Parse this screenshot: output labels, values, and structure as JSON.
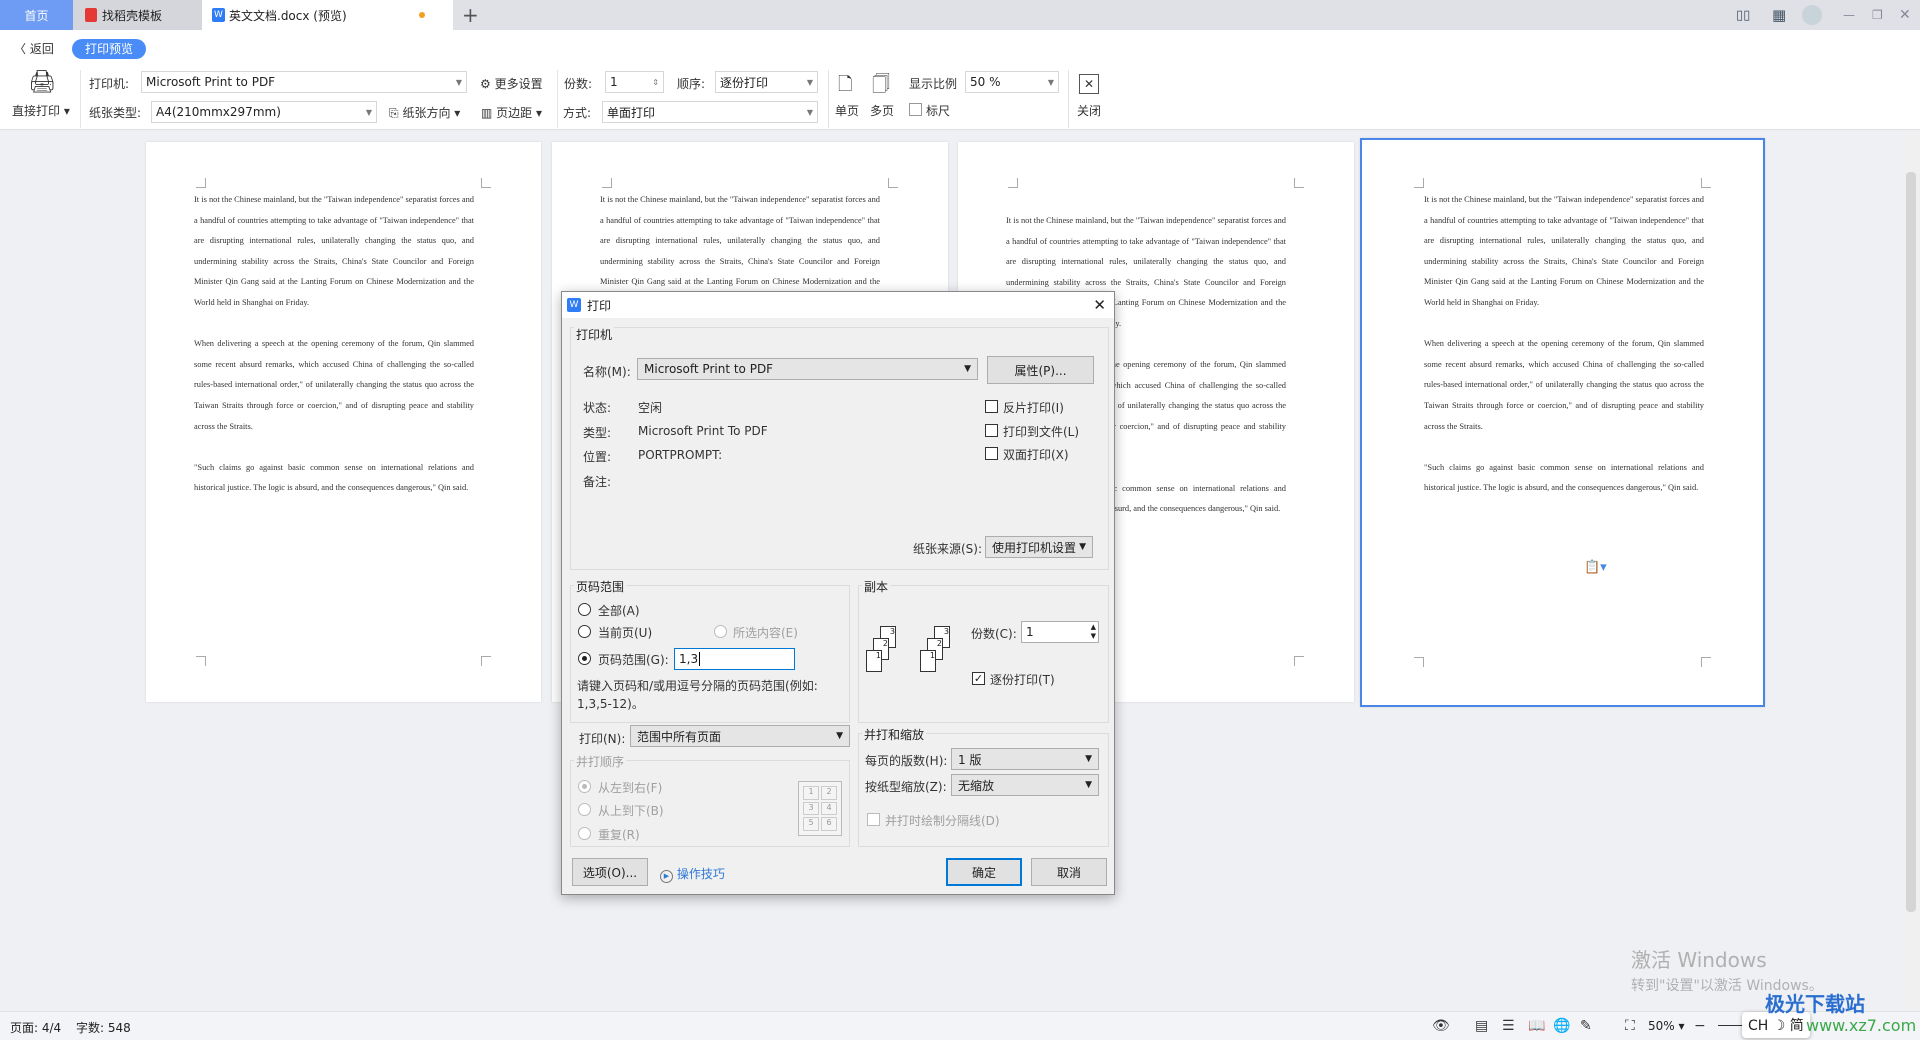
{
  "tabs": [
    {
      "label": "首页",
      "active": false
    },
    {
      "label": "找稻壳模板"
    },
    {
      "label": "英文文档.docx (预览)",
      "modified": true
    }
  ],
  "new_tab": "+",
  "nav": {
    "back": "返回",
    "mode": "打印预览"
  },
  "toolbar": {
    "direct_print": "直接打印",
    "printer_label": "打印机:",
    "printer": "Microsoft Print to PDF",
    "more_settings": "更多设置",
    "copies_label": "份数:",
    "copies": "1",
    "order_label": "顺序:",
    "order": "逐份打印",
    "paper_label": "纸张类型:",
    "paper": "A4(210mmx297mm)",
    "orientation": "纸张方向",
    "margins": "页边距",
    "mode_label": "方式:",
    "mode": "单面打印",
    "single_page": "单页",
    "multi_page": "多页",
    "zoom_label": "显示比例",
    "zoom": "50 %",
    "ruler": "标尺",
    "close": "关闭"
  },
  "document": {
    "paragraphs": [
      "It is not the Chinese mainland, but the \"Taiwan independence\" separatist forces and a handful of countries attempting to take advantage of \"Taiwan independence\" that are disrupting international rules, unilaterally changing the status quo, and undermining stability across the Straits, China's State Councilor and Foreign Minister Qin Gang said at the Lanting Forum on Chinese Modernization and the World held in Shanghai on Friday.",
      "When delivering a speech at the opening ceremony of the forum, Qin slammed some recent absurd remarks, which accused China of challenging the so-called rules-based international order,\" of unilaterally changing the status quo across the Taiwan Straits through force or coercion,\" and of disrupting peace and stability across the Straits.",
      "\"Such claims go against basic common sense on international relations and historical justice. The logic is absurd, and the consequences dangerous,\" Qin said."
    ]
  },
  "dialog": {
    "title": "打印",
    "printer_group": "打印机",
    "name_label": "名称(M):",
    "name": "Microsoft Print to PDF",
    "properties": "属性(P)...",
    "status_label": "状态:",
    "status": "空闲",
    "type_label": "类型:",
    "type": "Microsoft Print To PDF",
    "location_label": "位置:",
    "location": "PORTPROMPT:",
    "comment_label": "备注:",
    "reverse": "反片打印(I)",
    "to_file": "打印到文件(L)",
    "duplex": "双面打印(X)",
    "source_label": "纸张来源(S):",
    "source": "使用打印机设置",
    "range_group": "页码范围",
    "all": "全部(A)",
    "current": "当前页(U)",
    "selection": "所选内容(E)",
    "pages": "页码范围(G):",
    "pages_value": "1,3",
    "hint1": "请键入页码和/或用逗号分隔的页码范围(例如:",
    "hint2": "1,3,5-12)。",
    "copies_group": "副本",
    "copies_label": "份数(C):",
    "copies": "1",
    "collate": "逐份打印(T)",
    "print_label": "打印(N):",
    "print": "范围中所有页面",
    "order_group": "并打顺序",
    "ltr": "从左到右(F)",
    "ttb": "从上到下(B)",
    "repeat": "重复(R)",
    "scale_group": "并打和缩放",
    "per_sheet_label": "每页的版数(H):",
    "per_sheet": "1 版",
    "scale_label": "按纸型缩放(Z):",
    "scale": "无缩放",
    "draw_lines": "并打时绘制分隔线(D)",
    "options": "选项(O)...",
    "tips": "操作技巧",
    "ok": "确定",
    "cancel": "取消"
  },
  "statusbar": {
    "page": "页面: 4/4",
    "words": "字数: 548",
    "zoom": "50%",
    "ime": "CH ☽ 简"
  },
  "watermark": {
    "line1": "激活 Windows",
    "line2": "转到\"设置\"以激活 Windows。",
    "logo": "极光下载站",
    "url": "www.xz7.com"
  },
  "colors": {
    "accent": "#4a8cf7",
    "tab_home": "#6e9bf3",
    "selected_page_border": "#4a86e8"
  }
}
